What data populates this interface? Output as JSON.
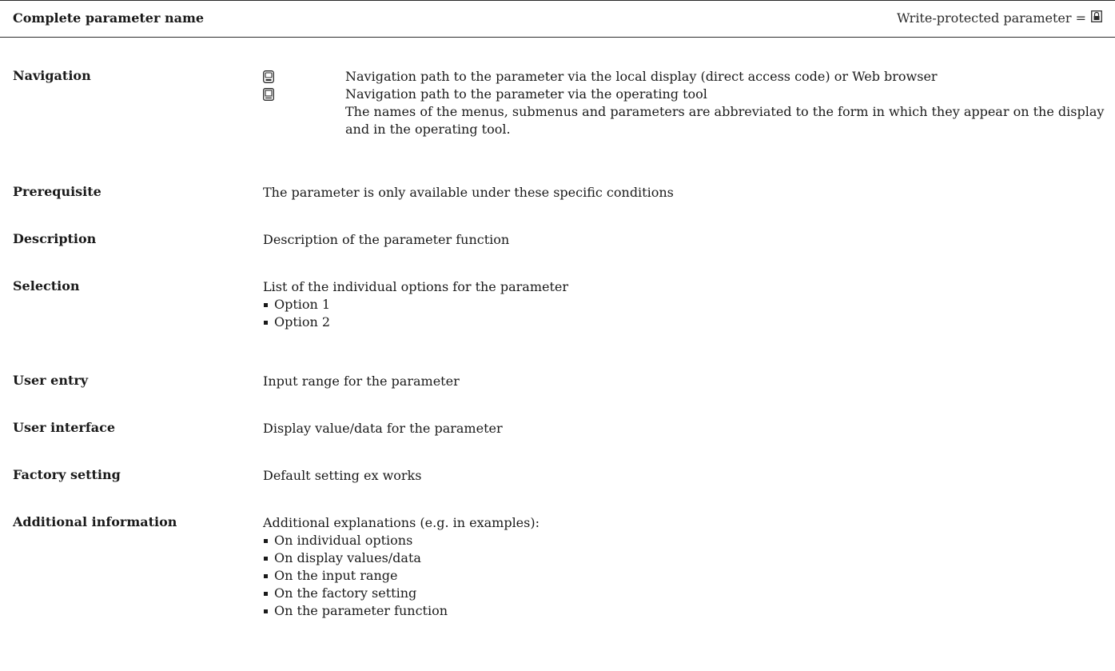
{
  "header": {
    "title": "Complete parameter name",
    "write_protected": "Write-protected parameter ="
  },
  "rows": {
    "navigation": {
      "label": "Navigation",
      "line1_icon": "local-display-icon",
      "line1": "Navigation path to the parameter via the local display (direct access code) or Web browser",
      "line2_icon": "operating-tool-icon",
      "line2": "Navigation path to the parameter via the operating tool",
      "note": "The names of the menus, submenus and parameters are abbreviated to the form in which they appear on the display and in the operating tool."
    },
    "prerequisite": {
      "label": "Prerequisite",
      "text": "The parameter is only available under these specific conditions"
    },
    "description": {
      "label": "Description",
      "text": "Description of the parameter function"
    },
    "selection": {
      "label": "Selection",
      "text": "List of the individual options for the parameter",
      "items": [
        "Option 1",
        "Option 2"
      ]
    },
    "user_entry": {
      "label": "User entry",
      "text": "Input range for the parameter"
    },
    "user_interface": {
      "label": "User interface",
      "text": "Display value/data for the parameter"
    },
    "factory_setting": {
      "label": "Factory setting",
      "text": "Default setting ex works"
    },
    "additional_information": {
      "label": "Additional information",
      "text": "Additional explanations (e.g. in examples):",
      "items": [
        "On individual options",
        "On display values/data",
        "On the input range",
        "On the factory setting",
        "On the parameter function"
      ]
    }
  },
  "icons": {
    "write_protect": "lock-icon"
  }
}
